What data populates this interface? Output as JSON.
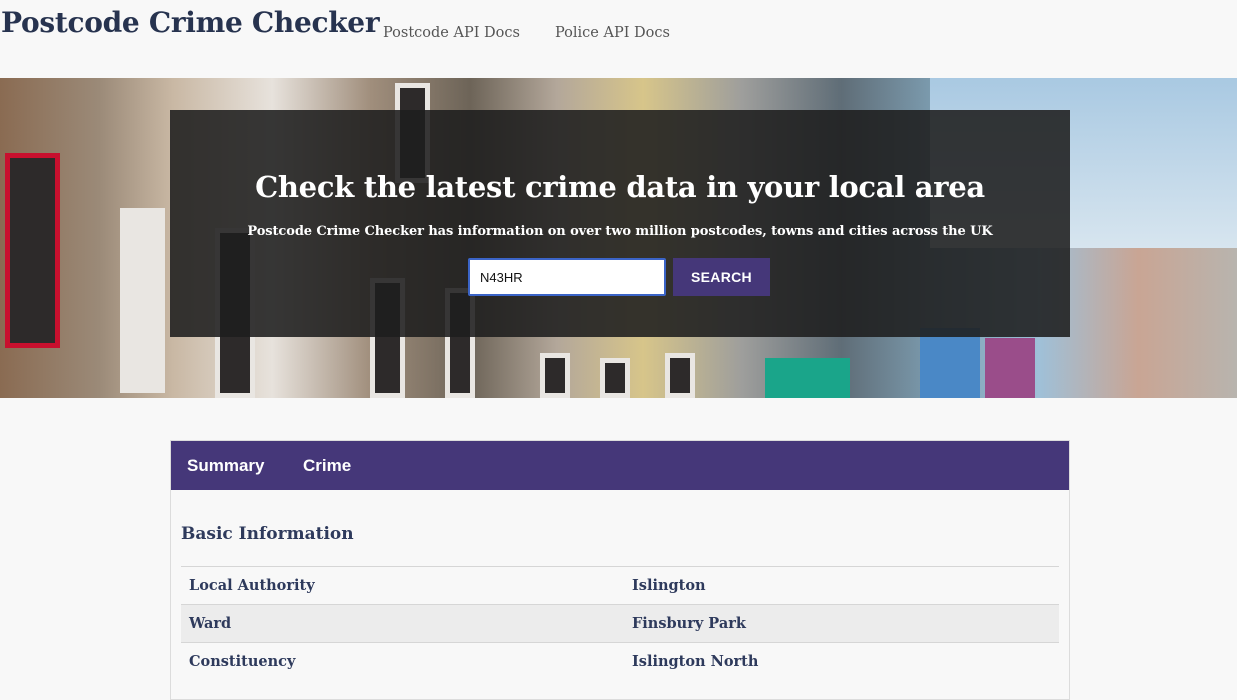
{
  "header": {
    "brand": "Postcode Crime Checker",
    "nav": [
      {
        "label": "Postcode API Docs"
      },
      {
        "label": "Police API Docs"
      }
    ]
  },
  "hero": {
    "title": "Check the latest crime data in your local area",
    "subtitle": "Postcode Crime Checker has information on over two million postcodes, towns and cities across the UK",
    "search": {
      "value": "N43HR",
      "button_label": "SEARCH"
    }
  },
  "results": {
    "tabs": [
      {
        "label": "Summary"
      },
      {
        "label": "Crime"
      }
    ],
    "section_title": "Basic Information",
    "rows": [
      {
        "key": "Local Authority",
        "value": "Islington"
      },
      {
        "key": "Ward",
        "value": "Finsbury Park"
      },
      {
        "key": "Constituency",
        "value": "Islington North"
      }
    ]
  },
  "colors": {
    "accent_purple": "#453779",
    "input_focus": "#3b64c7",
    "heading": "#27334f"
  }
}
